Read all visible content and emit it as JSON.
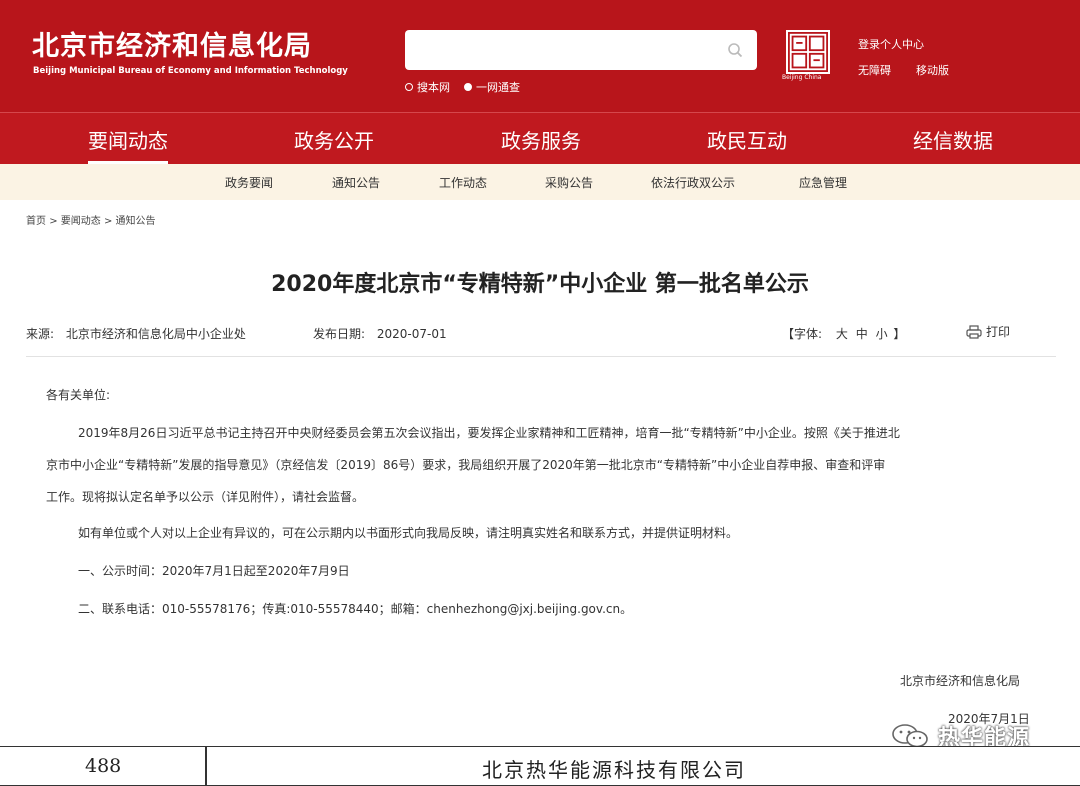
{
  "header": {
    "title_cn": "北京市经济和信息化局",
    "title_en": "Beijing Municipal Bureau of Economy and Information Technology",
    "search": {
      "value": "",
      "placeholder": ""
    },
    "scope": [
      "搜本网",
      "一网通查"
    ],
    "seal_caption": "Beijing China",
    "user_center": "登录个人中心",
    "accessibility": "无障碍",
    "mobile": "移动版",
    "accent_color": "#b8151b"
  },
  "nav": [
    "要闻动态",
    "政务公开",
    "政务服务",
    "政民互动",
    "经信数据"
  ],
  "subnav": [
    "政务要闻",
    "通知公告",
    "工作动态",
    "采购公告",
    "依法行政双公示",
    "应急管理"
  ],
  "breadcrumb": [
    "首页",
    "要闻动态",
    "通知公告"
  ],
  "article": {
    "title": "2020年度北京市“专精特新”中小企业 第一批名单公示",
    "source_label": "来源:",
    "source": "北京市经济和信息化局中小企业处",
    "date_label": "发布日期:",
    "date": "2020-07-01",
    "font_label": "【字体:",
    "font_sizes": [
      "大",
      "中",
      "小"
    ],
    "font_close": "】",
    "print": "打印",
    "salutation": "各有关单位:",
    "p1_line1": "2019年8月26日习近平总书记主持召开中央财经委员会第五次会议指出，要发挥企业家精神和工匠精神，培育一批“专精特新”中小企业。按照《关于推进北",
    "p1_line2": "京市中小企业“专精特新”发展的指导意见》（京经信发〔2019〕86号）要求，我局组织开展了2020年第一批北京市“专精特新”中小企业自荐申报、审查和评审",
    "p1_line3": "工作。现将拟认定名单予以公示（详见附件），请社会监督。",
    "p2": "如有单位或个人对以上企业有异议的，可在公示期内以书面形式向我局反映，请注明真实姓名和联系方式，并提供证明材料。",
    "p3": "一、公示时间：2020年7月1日起至2020年7月9日",
    "p4": "二、联系电话：010-55578176；传真:010-55578440；邮箱：chenhezhong@jxj.beijing.gov.cn。",
    "sign_org": "北京市经济和信息化局",
    "sign_date": "2020年7月1日"
  },
  "watermark": "热华能源",
  "table_row": {
    "number": "488",
    "company": "北京热华能源科技有限公司"
  }
}
